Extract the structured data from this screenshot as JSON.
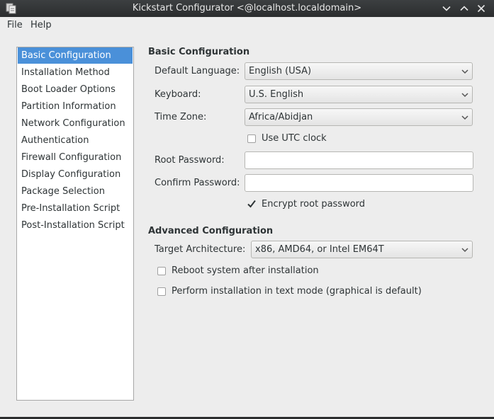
{
  "window": {
    "title": "Kickstart Configurator <@localhost.localdomain>",
    "minimize_icon": "chevron-down-icon",
    "maximize_icon": "chevron-up-icon",
    "close_icon": "close-icon"
  },
  "menubar": {
    "file": "File",
    "help": "Help"
  },
  "sidebar": {
    "selected_index": 0,
    "items": [
      {
        "label": "Basic Configuration"
      },
      {
        "label": "Installation Method"
      },
      {
        "label": "Boot Loader Options"
      },
      {
        "label": "Partition Information"
      },
      {
        "label": "Network Configuration"
      },
      {
        "label": "Authentication"
      },
      {
        "label": "Firewall Configuration"
      },
      {
        "label": "Display Configuration"
      },
      {
        "label": "Package Selection"
      },
      {
        "label": "Pre-Installation Script"
      },
      {
        "label": "Post-Installation Script"
      }
    ]
  },
  "basic": {
    "section_title": "Basic Configuration",
    "language_label": "Default Language:",
    "language_value": "English (USA)",
    "keyboard_label": "Keyboard:",
    "keyboard_value": "U.S. English",
    "timezone_label": "Time Zone:",
    "timezone_value": "Africa/Abidjan",
    "utc_label": "Use UTC clock",
    "utc_checked": false,
    "root_password_label": "Root Password:",
    "root_password_value": "",
    "confirm_password_label": "Confirm Password:",
    "confirm_password_value": "",
    "encrypt_label": "Encrypt root password",
    "encrypt_checked": true
  },
  "advanced": {
    "section_title": "Advanced Configuration",
    "arch_label": "Target Architecture:",
    "arch_value": "x86, AMD64, or Intel EM64T",
    "reboot_label": "Reboot system after installation",
    "reboot_checked": false,
    "textmode_label": "Perform installation in text mode (graphical is default)",
    "textmode_checked": false
  }
}
